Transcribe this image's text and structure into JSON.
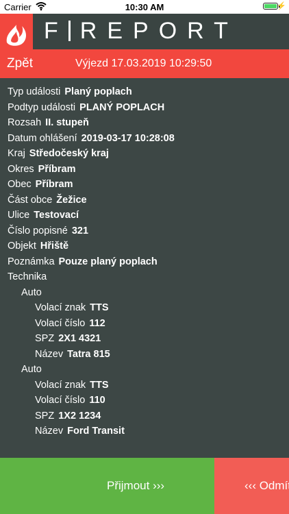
{
  "status": {
    "carrier": "Carrier",
    "time": "10:30 AM"
  },
  "header": {
    "logo_left": "F",
    "logo_right": "REPORT"
  },
  "nav": {
    "back": "Zpět",
    "title": "Výjezd 17.03.2019 10:29:50"
  },
  "details": [
    {
      "label": "Typ události",
      "value": "Planý poplach"
    },
    {
      "label": "Podtyp události",
      "value": "PLANÝ POPLACH"
    },
    {
      "label": "Rozsah",
      "value": "II. stupeň"
    },
    {
      "label": "Datum ohlášení",
      "value": "2019-03-17 10:28:08"
    },
    {
      "label": "Kraj",
      "value": "Středočeský kraj"
    },
    {
      "label": "Okres",
      "value": "Příbram"
    },
    {
      "label": "Obec",
      "value": "Příbram"
    },
    {
      "label": "Část obce",
      "value": "Žežice"
    },
    {
      "label": "Ulice",
      "value": "Testovací"
    },
    {
      "label": "Číslo popisné",
      "value": "321"
    },
    {
      "label": "Objekt",
      "value": "Hřiště"
    },
    {
      "label": "Poznámka",
      "value": "Pouze planý poplach"
    },
    {
      "label": "Technika",
      "value": ""
    }
  ],
  "vehicles": [
    {
      "heading": "Auto",
      "call_sign_label": "Volací znak",
      "call_sign": "TTS",
      "call_no_label": "Volací číslo",
      "call_no": "112",
      "plate_label": "SPZ",
      "plate": "2X1 4321",
      "name_label": "Název",
      "name": "Tatra 815"
    },
    {
      "heading": "Auto",
      "call_sign_label": "Volací znak",
      "call_sign": "TTS",
      "call_no_label": "Volací číslo",
      "call_no": "110",
      "plate_label": "SPZ",
      "plate": "1X2 1234",
      "name_label": "Název",
      "name": "Ford Transit"
    }
  ],
  "actions": {
    "accept": "Přijmout ›››",
    "decline": "‹‹‹  Odmítnout"
  },
  "colors": {
    "accent": "#f2473e",
    "accept": "#5fb444",
    "decline": "#f25d55",
    "background": "#3d4745"
  }
}
